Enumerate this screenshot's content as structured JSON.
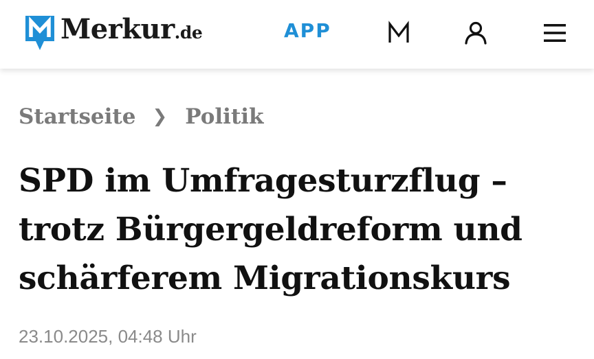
{
  "header": {
    "logo_name": "Merkur",
    "logo_tld": ".de",
    "app_label": "APP",
    "brand_color": "#1f8fd6",
    "icons": [
      "merkur-m-icon",
      "user-icon",
      "menu-icon"
    ]
  },
  "breadcrumb": {
    "items": [
      "Startseite",
      "Politik"
    ],
    "separator": "❯"
  },
  "article": {
    "headline": "SPD im Umfragesturzflug – trotz Bürgergeldreform und schärferem Migrationskurs",
    "date": "23.10.2025, 04:48 Uhr"
  }
}
